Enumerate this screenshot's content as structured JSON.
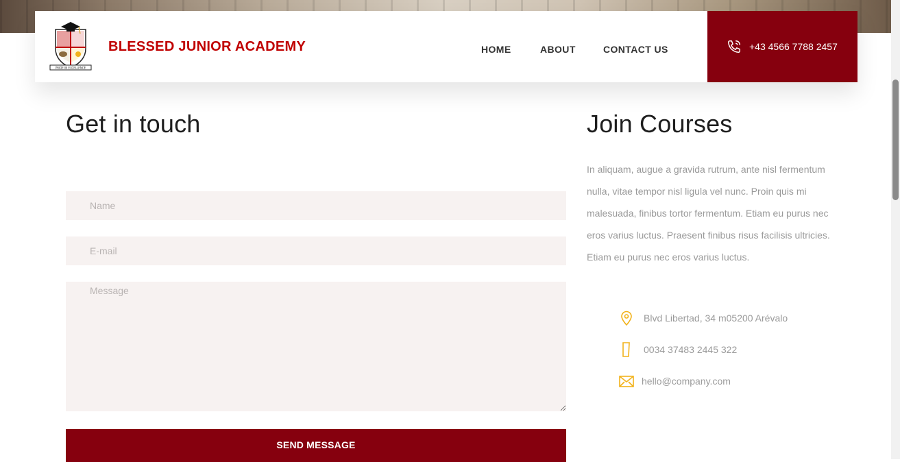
{
  "header": {
    "brand_name": "BLESSED JUNIOR ACADEMY",
    "logo_motto": "PRIDE IN EXCELLENCE",
    "nav": [
      {
        "label": "HOME"
      },
      {
        "label": "ABOUT"
      },
      {
        "label": "CONTACT US"
      }
    ],
    "phone": "+43 4566 7788 2457"
  },
  "form": {
    "title": "Get in touch",
    "name_placeholder": "Name",
    "email_placeholder": "E-mail",
    "message_placeholder": "Message",
    "submit_label": "SEND MESSAGE"
  },
  "courses": {
    "title": "Join Courses",
    "description": "In aliquam, augue a gravida rutrum, ante nisl fermentum nulla, vitae tempor nisl ligula vel nunc. Proin quis mi malesuada, finibus tortor fermentum. Etiam eu purus nec eros varius luctus. Praesent finibus risus facilisis ultricies. Etiam eu purus nec eros varius luctus.",
    "contacts": [
      {
        "icon": "location-pin-icon",
        "text": "Blvd Libertad, 34 m05200 Arévalo"
      },
      {
        "icon": "mobile-phone-icon",
        "text": "0034 37483 2445 322"
      },
      {
        "icon": "envelope-icon",
        "text": "hello@company.com"
      }
    ]
  },
  "colors": {
    "brand_red": "#c00000",
    "accent_maroon": "#86000e",
    "icon_gold": "#f2b21b",
    "input_bg": "#f7f2f1"
  }
}
